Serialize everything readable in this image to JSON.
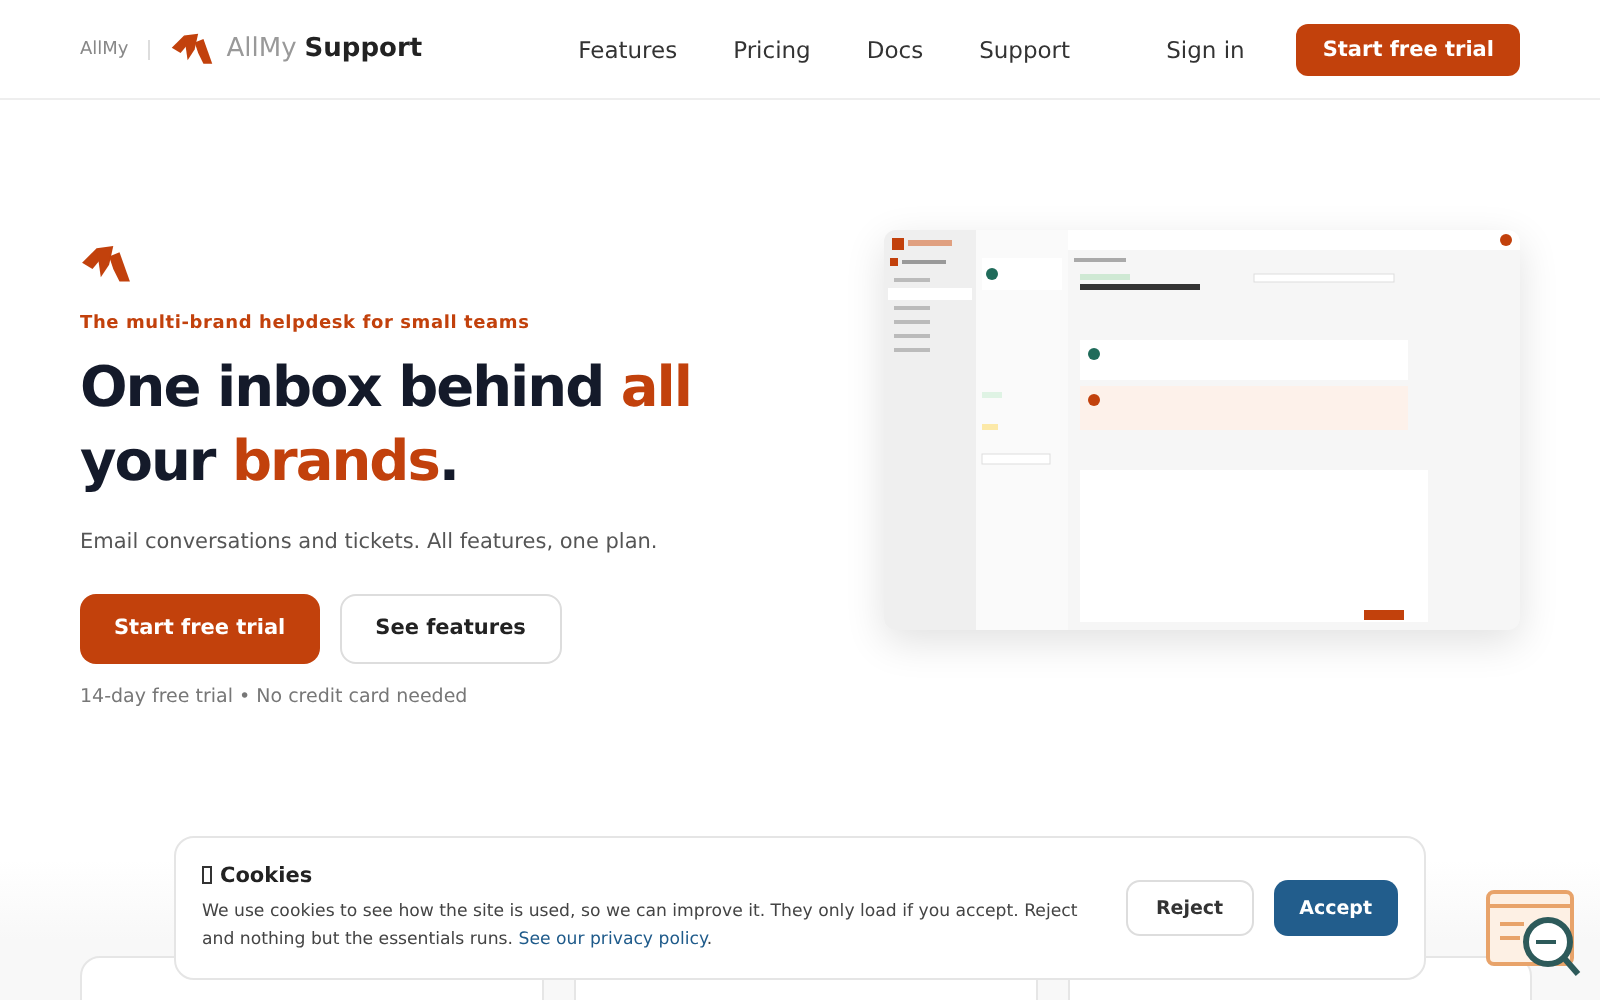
{
  "header": {
    "small_brand": "AllMy",
    "brand_light": "AllMy",
    "brand_bold": "Support",
    "nav": [
      "Features",
      "Pricing",
      "Docs",
      "Support"
    ],
    "sign_in": "Sign in",
    "cta": "Start free trial"
  },
  "hero": {
    "tagline": "The multi-brand helpdesk for small teams",
    "headline": [
      {
        "text": "One inbox behind ",
        "accent": false
      },
      {
        "text": "all",
        "accent": true
      },
      {
        "text": " your ",
        "accent": false
      },
      {
        "text": "brands",
        "accent": true
      },
      {
        "text": ".",
        "accent": false
      }
    ],
    "subtitle": "Email conversations and tickets. All features, one plan.",
    "primary": "Start free trial",
    "secondary": "See features",
    "note": "14-day free trial • No credit card needed"
  },
  "cookies": {
    "title": "Cookies",
    "text": "We use cookies to see how the site is used, so we can improve it. They only load if you accept. Reject and nothing but the essentials runs.",
    "link": "See our privacy policy",
    "after_link": ".",
    "reject": "Reject",
    "accept": "Accept"
  }
}
